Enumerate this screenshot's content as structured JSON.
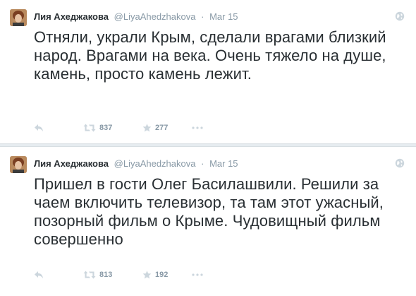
{
  "tweets": [
    {
      "author": "Лия Ахеджакова",
      "handle": "@LiyaAhedzhakova",
      "separator": "·",
      "time": "Mar 15",
      "text": "Отняли, украли Крым, сделали врагами близкий народ. Врагами на века. Очень тяжело на душе, камень, просто камень лежит.",
      "retweets": "837",
      "favorites": "277"
    },
    {
      "author": "Лия Ахеджакова",
      "handle": "@LiyaAhedzhakova",
      "separator": "·",
      "time": "Mar 15",
      "text": "Пришел в гости Олег Басилашвили. Решили за чаем включить телевизор, та там этот ужасный, позорный фильм о Крыме. Чудовищный фильм совершенно",
      "retweets": "813",
      "favorites": "192"
    }
  ],
  "icons": {
    "reply": "reply-icon",
    "retweet": "retweet-icon",
    "favorite": "star-icon",
    "more": "more-icon",
    "globe": "globe-icon"
  },
  "colors": {
    "text": "#292f33",
    "meta": "#8899a6",
    "icon": "#ccd6dd",
    "separator": "#e6ecf0"
  }
}
